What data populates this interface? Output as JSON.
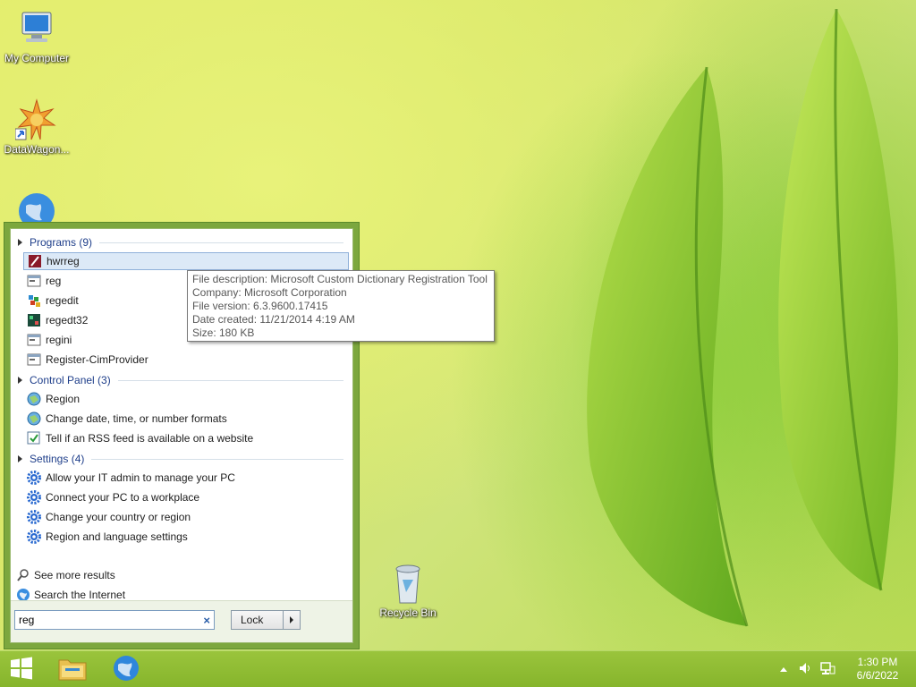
{
  "desktop": {
    "icons": [
      {
        "label": "My Computer",
        "icon": "computer-icon"
      },
      {
        "label": "DataWagon...",
        "icon": "datawagon-shortcut-icon"
      },
      {
        "label": "",
        "icon": "globe-icon"
      },
      {
        "label": "Recycle Bin",
        "icon": "recycle-bin-icon"
      }
    ]
  },
  "start_menu": {
    "groups": {
      "programs": {
        "label": "Programs (9)"
      },
      "control_panel": {
        "label": "Control Panel (3)"
      },
      "settings": {
        "label": "Settings (4)"
      }
    },
    "programs": [
      {
        "label": "hwrreg",
        "icon": "hwrreg-app-icon"
      },
      {
        "label": "reg",
        "icon": "console-app-icon"
      },
      {
        "label": "regedit",
        "icon": "regedit-icon"
      },
      {
        "label": "regedt32",
        "icon": "regedt32-icon"
      },
      {
        "label": "regini",
        "icon": "console-app-icon"
      },
      {
        "label": "Register-CimProvider",
        "icon": "console-app-icon"
      }
    ],
    "control_panel": [
      {
        "label": "Region",
        "icon": "region-globe-icon"
      },
      {
        "label": "Change date, time, or number formats",
        "icon": "region-globe-icon"
      },
      {
        "label": "Tell if an RSS feed is available on a website",
        "icon": "rss-check-icon"
      }
    ],
    "settings": [
      {
        "label": "Allow your IT admin to manage your PC",
        "icon": "gear-icon"
      },
      {
        "label": "Connect your PC to a workplace",
        "icon": "gear-icon"
      },
      {
        "label": "Change your country or region",
        "icon": "gear-icon"
      },
      {
        "label": "Region and language settings",
        "icon": "gear-icon"
      }
    ],
    "see_more": "See more results",
    "search_internet": "Search the Internet",
    "search": {
      "value": "reg",
      "clear_glyph": "×"
    },
    "lock_label": "Lock"
  },
  "tooltip": {
    "description": "File description: Microsoft Custom Dictionary Registration Tool",
    "company": "Company: Microsoft Corporation",
    "version": "File version: 6.3.9600.17415",
    "created": "Date created: 11/21/2014 4:19 AM",
    "size": "Size: 180 KB"
  },
  "taskbar": {
    "pinned": [
      {
        "icon": "windows-start-icon"
      },
      {
        "icon": "file-explorer-icon"
      },
      {
        "icon": "internet-explorer-globe-icon"
      }
    ],
    "clock": {
      "time": "1:30 PM",
      "date": "6/6/2022"
    }
  },
  "colors": {
    "menu_frame": "#7ca73e",
    "taskbar": "#8fbd33",
    "group_header_text": "#1e3e8a",
    "selection": "#dce9f7"
  }
}
